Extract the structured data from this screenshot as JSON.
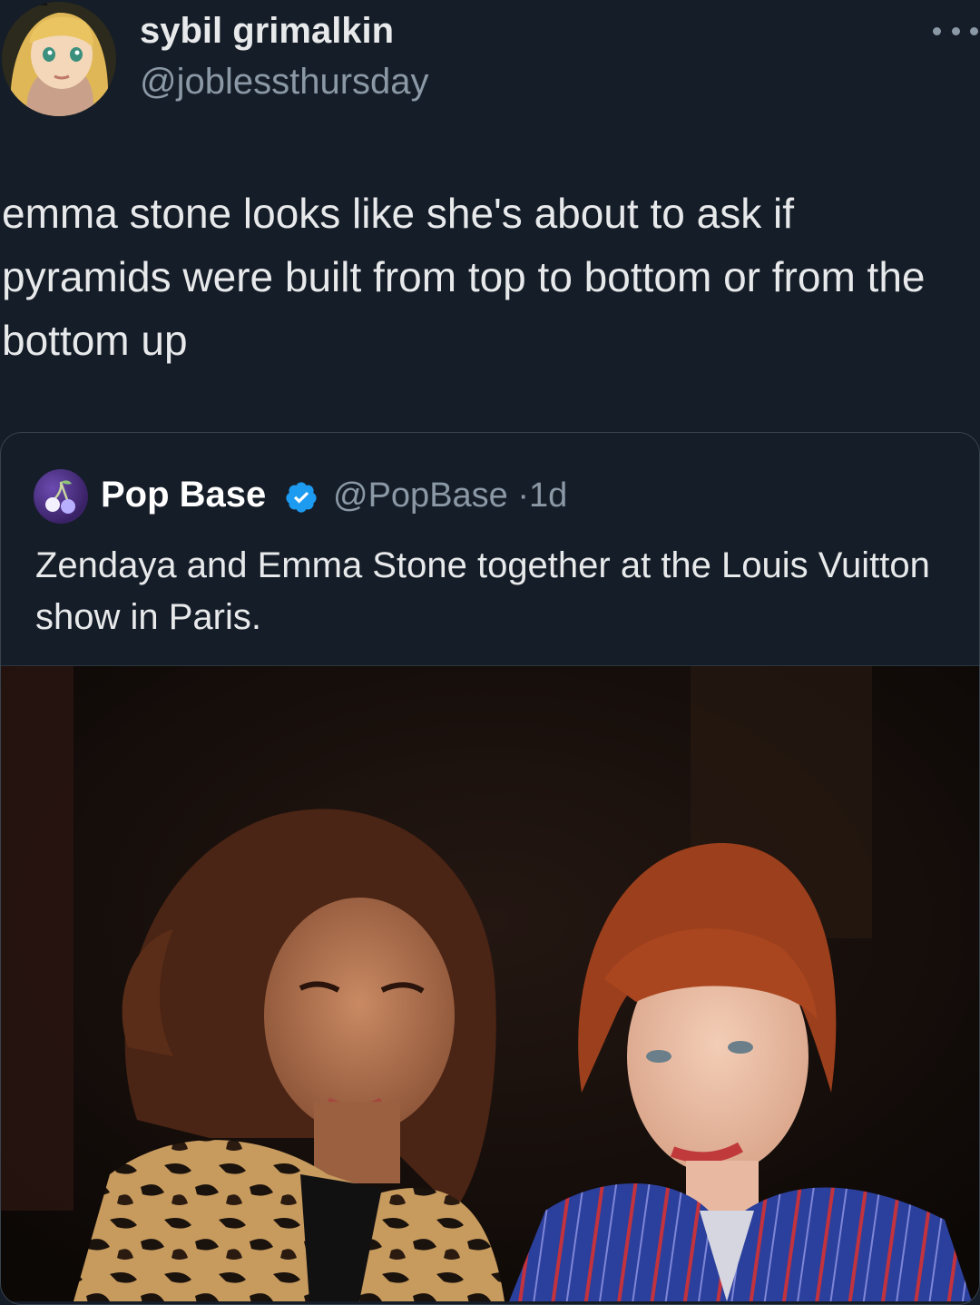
{
  "tweet": {
    "display_name": "sybil grimalkin",
    "handle": "@joblessthursday",
    "avatar_icon": "zelda-avatar-icon",
    "more_icon": "more-options-icon",
    "text": "emma stone looks like she's about to ask if pyramids were built from top to bottom or from the bottom up"
  },
  "quoted_tweet": {
    "display_name": "Pop Base",
    "verified_icon": "verified-badge-icon",
    "handle": "@PopBase",
    "separator": "·",
    "time": "1d",
    "text": "Zendaya and Emma Stone together at the Louis Vuitton show in Paris.",
    "avatar_icon": "cherry-icon",
    "photo": "photo-of-two-women"
  },
  "colors": {
    "background": "#151d28",
    "text_primary": "#e7e9ea",
    "text_secondary": "#8b98a5",
    "verified_blue": "#1d9bf0",
    "border": "#38444d"
  }
}
